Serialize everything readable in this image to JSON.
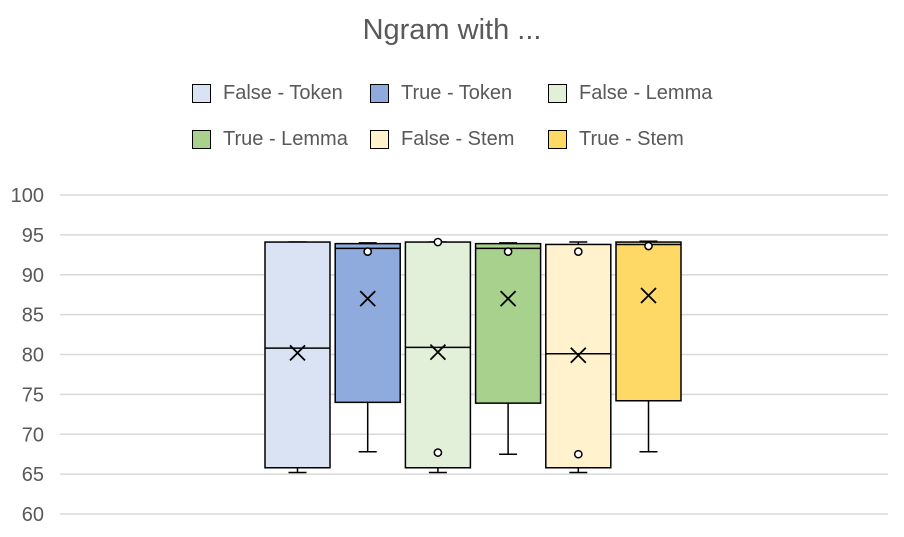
{
  "chart_data": {
    "type": "box",
    "title": "Ngram with ...",
    "xlabel": "",
    "ylabel": "",
    "ylim": [
      60,
      100
    ],
    "yticks": [
      60,
      65,
      70,
      75,
      80,
      85,
      90,
      95,
      100
    ],
    "grid": true,
    "legend_position": "top",
    "series": [
      {
        "name": "False - Token",
        "color": "#DAE3F3",
        "min": 65.2,
        "q1": 65.8,
        "median": 80.8,
        "q3": 94.1,
        "max": 94.1,
        "mean": 80.2,
        "outliers": []
      },
      {
        "name": "True - Token",
        "color": "#8FAADC",
        "min": 67.8,
        "q1": 74.0,
        "median": 93.3,
        "q3": 93.9,
        "max": 94.0,
        "mean": 87.0,
        "outliers": [
          92.9
        ]
      },
      {
        "name": "False - Lemma",
        "color": "#E2F0D9",
        "min": 65.2,
        "q1": 65.8,
        "median": 80.9,
        "q3": 94.1,
        "max": 94.1,
        "mean": 80.3,
        "outliers": [
          94.1,
          67.7
        ]
      },
      {
        "name": "True - Lemma",
        "color": "#A9D18E",
        "min": 67.5,
        "q1": 73.9,
        "median": 93.3,
        "q3": 93.9,
        "max": 94.0,
        "mean": 87.0,
        "outliers": [
          92.9
        ]
      },
      {
        "name": "False - Stem",
        "color": "#FFF2CC",
        "min": 65.2,
        "q1": 65.8,
        "median": 80.1,
        "q3": 93.8,
        "max": 94.1,
        "mean": 79.9,
        "outliers": [
          92.9,
          67.5
        ]
      },
      {
        "name": "True - Stem",
        "color": "#FFD966",
        "min": 67.8,
        "q1": 74.2,
        "median": 93.8,
        "q3": 94.1,
        "max": 94.2,
        "mean": 87.4,
        "outliers": [
          93.6
        ]
      }
    ]
  }
}
